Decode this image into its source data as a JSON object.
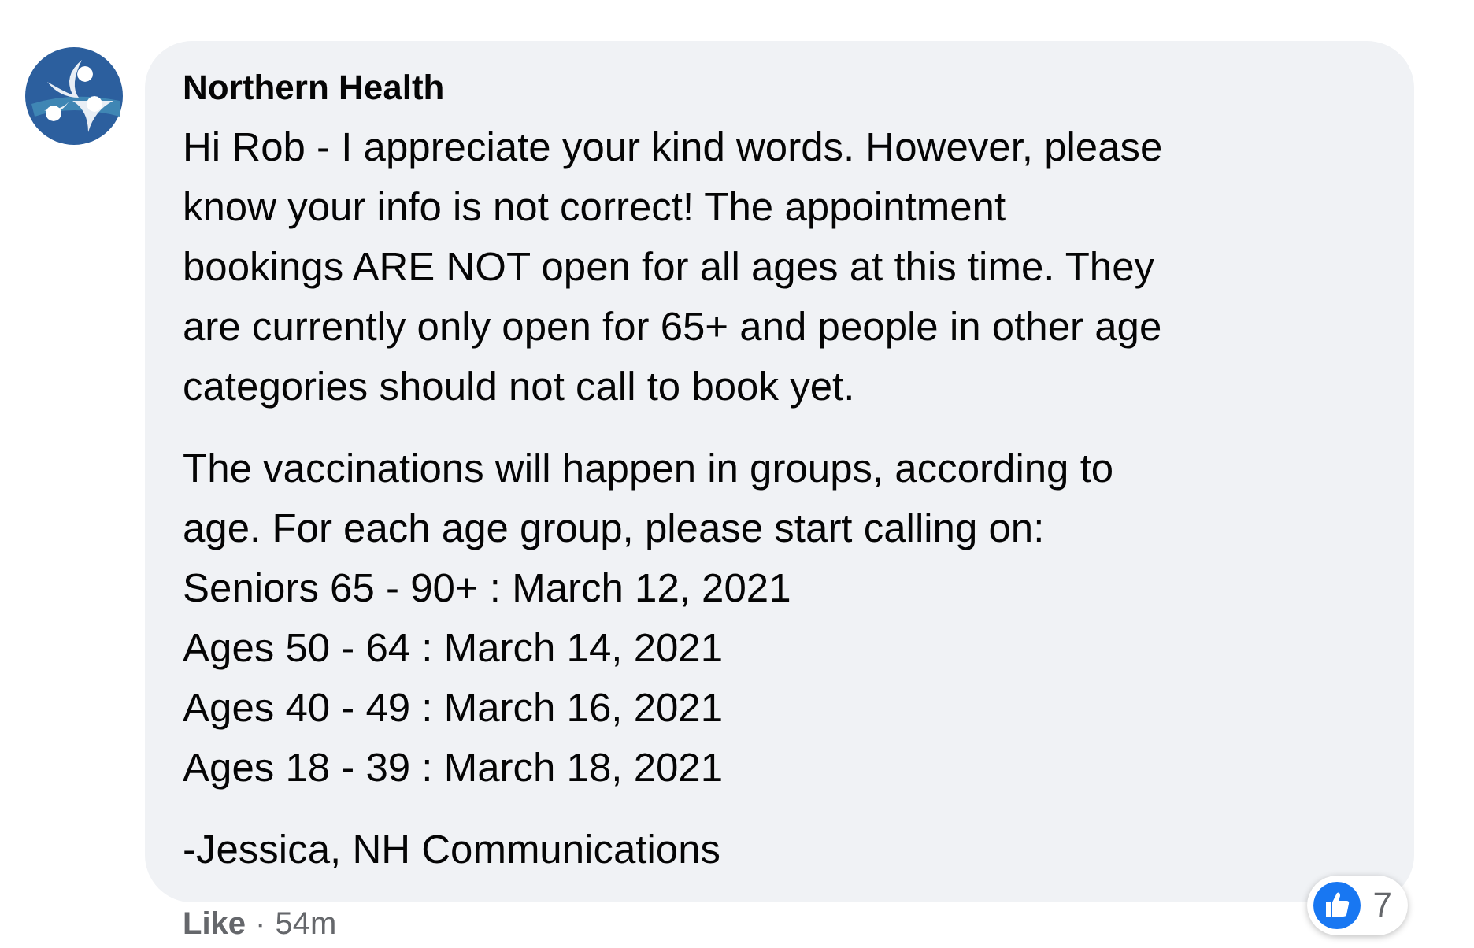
{
  "comment": {
    "author": "Northern Health",
    "paragraphs": [
      [
        "Hi Rob - I appreciate your kind words. However, please\nknow your info is not correct! The appointment\nbookings ARE NOT open for all ages at this time. They\nare currently only open for 65+ and people in other age\ncategories should not call to book yet."
      ],
      [
        "The vaccinations will happen in groups, according to\nage. For each age group, please start calling on:",
        "Seniors 65 - 90+ : March 12, 2021",
        "Ages 50 - 64 : March 14, 2021",
        "Ages 40 - 49 : March 16, 2021",
        "Ages 18 - 39 : March 18, 2021"
      ],
      [
        "-Jessica, NH Communications"
      ]
    ],
    "actions": [
      {
        "label": "Like"
      },
      {
        "label": "54m",
        "kind": "time"
      }
    ],
    "action_separator": "·",
    "reactions": {
      "count": "7"
    }
  }
}
